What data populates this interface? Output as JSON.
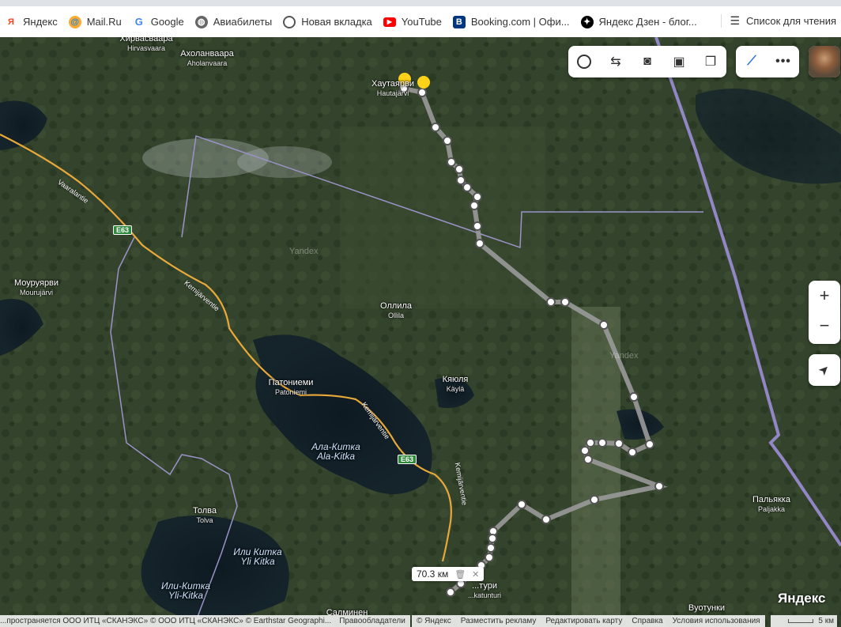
{
  "bookmarks": {
    "items": [
      {
        "label": "Яндекс",
        "icon": "yandex-icon",
        "color": "#fc3f1d"
      },
      {
        "label": "Mail.Ru",
        "icon": "mailru-icon",
        "color": "#168de2"
      },
      {
        "label": "Google",
        "icon": "google-icon",
        "color": "#4285f4"
      },
      {
        "label": "Авиабилеты",
        "icon": "globe-icon",
        "color": "#555555"
      },
      {
        "label": "Новая вкладка",
        "icon": "chrome-icon",
        "color": "#555555"
      },
      {
        "label": "YouTube",
        "icon": "youtube-icon",
        "color": "#ff0000"
      },
      {
        "label": "Booking.com | Офи...",
        "icon": "booking-icon",
        "color": "#003580"
      },
      {
        "label": "Яндекс Дзен - блог...",
        "icon": "zen-icon",
        "color": "#000000"
      }
    ],
    "reading_list": "Список для чтения"
  },
  "map": {
    "places": [
      {
        "ru": "Хирвасваара",
        "fi": "Hirvasvaara"
      },
      {
        "ru": "Ахоланваара",
        "fi": "Aholanvaara"
      },
      {
        "ru": "Хаутаярви",
        "fi": "Hautajärvi"
      },
      {
        "ru": "Моуруярви",
        "fi": "Mourujärvi"
      },
      {
        "ru": "Оллила",
        "fi": "Ollila"
      },
      {
        "ru": "Патониеми",
        "fi": "Patoniemi"
      },
      {
        "ru": "Кяюля",
        "fi": "Käylä"
      },
      {
        "ru": "Ала-Китка",
        "fi": "Ala-Kitka"
      },
      {
        "ru": "Толва",
        "fi": "Tolva"
      },
      {
        "ru": "Или Китка",
        "fi": "Yli Kitka"
      },
      {
        "ru": "Или-Китка",
        "fi": "Yli-Kitka"
      },
      {
        "ru": "Пальякка",
        "fi": "Paljakka"
      },
      {
        "ru": "Вуотунки",
        "fi": ""
      },
      {
        "ru": "Салминен",
        "fi": ""
      },
      {
        "ru": "...тури",
        "fi": "...katunturi"
      }
    ],
    "roads": {
      "e63": "E63",
      "street_a": "Vaaralantie",
      "street_b": "Kemijärventie"
    },
    "watermark": "Yandex",
    "distance": "70.3 км",
    "logo": "Яндекс",
    "scale": "5 км"
  },
  "footer": {
    "attribution": "...пространяется ООО ИТЦ «СКАНЭКС» © ООО ИТЦ «СКАНЭКС» © Earthstar Geographi...",
    "rights_link": "Правообладатели",
    "links": [
      "© Яндекс",
      "Разместить рекламу",
      "Редактировать карту",
      "Справка",
      "Условия использования"
    ]
  }
}
